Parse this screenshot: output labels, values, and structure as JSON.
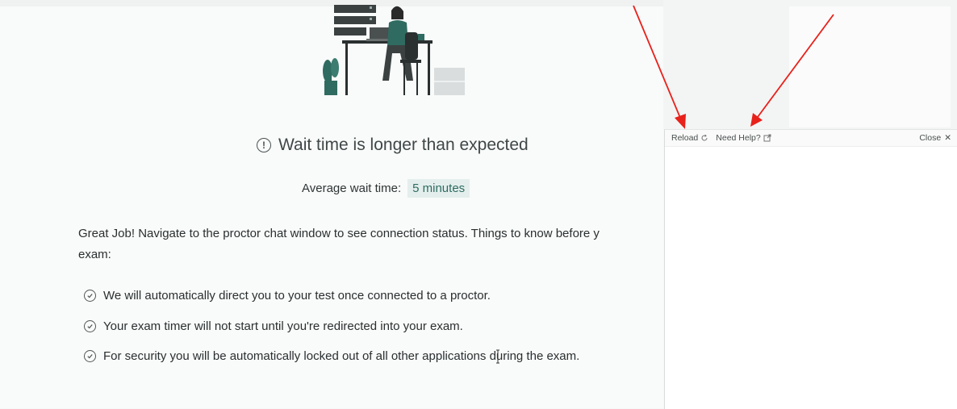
{
  "main": {
    "wait_title": "Wait time is longer than expected",
    "average_label": "Average wait time:",
    "average_value": "5 minutes",
    "description_line1": "Great Job! Navigate to the proctor chat window to see connection status. Things to know before y",
    "description_line2": "exam:",
    "checklist": [
      "We will automatically direct you to your test once connected to a proctor.",
      "Your exam timer will not start until you're redirected into your exam.",
      "For security you will be automatically locked out of all other applications during the exam."
    ]
  },
  "chat_panel": {
    "reload_label": "Reload",
    "help_label": "Need Help?",
    "close_label": "Close",
    "close_glyph": "✕"
  },
  "icons": {
    "wait_title": "exclamation-circle-icon",
    "checklist": "check-circle-icon",
    "reload": "reload-icon",
    "help": "external-link-icon",
    "close": "close-icon"
  },
  "colors": {
    "annotation_arrow": "#e8211b",
    "accent_teal": "#2f6b60"
  }
}
